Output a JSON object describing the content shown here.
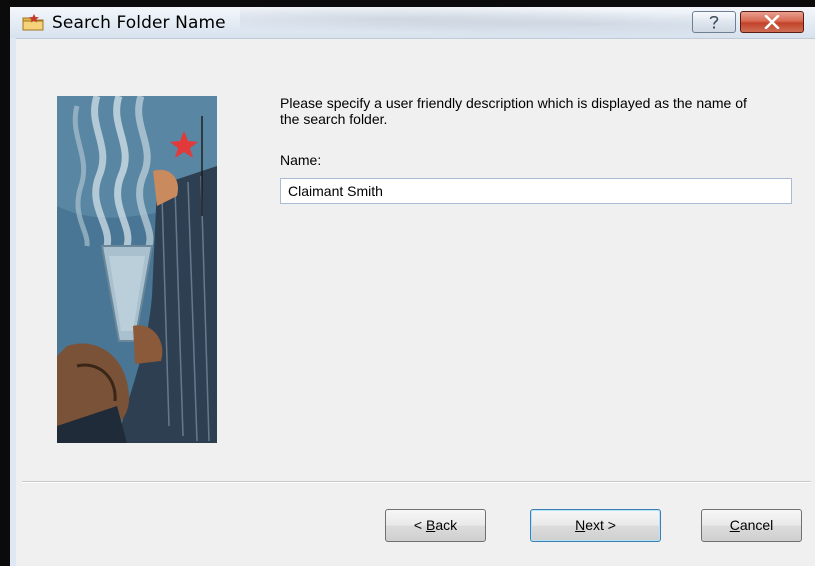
{
  "window": {
    "title": "Search Folder Name",
    "app_icon": "search-folder-icon",
    "help_icon": "help-question-icon",
    "close_icon": "close-x-icon"
  },
  "content": {
    "description": "Please specify a user friendly description which is displayed as the name of the search folder.",
    "name_label": "Name:",
    "name_value": "Claimant Smith"
  },
  "buttons": {
    "back": {
      "prefix": "< ",
      "mnemonic": "B",
      "rest": "ack"
    },
    "next": {
      "mnemonic": "N",
      "rest": "ext >"
    },
    "cancel": {
      "mnemonic": "C",
      "rest": "ancel"
    }
  },
  "colors": {
    "close_button": "#c2432a",
    "dialog_background": "#f0f0f0",
    "input_border": "#a9bcd3"
  }
}
